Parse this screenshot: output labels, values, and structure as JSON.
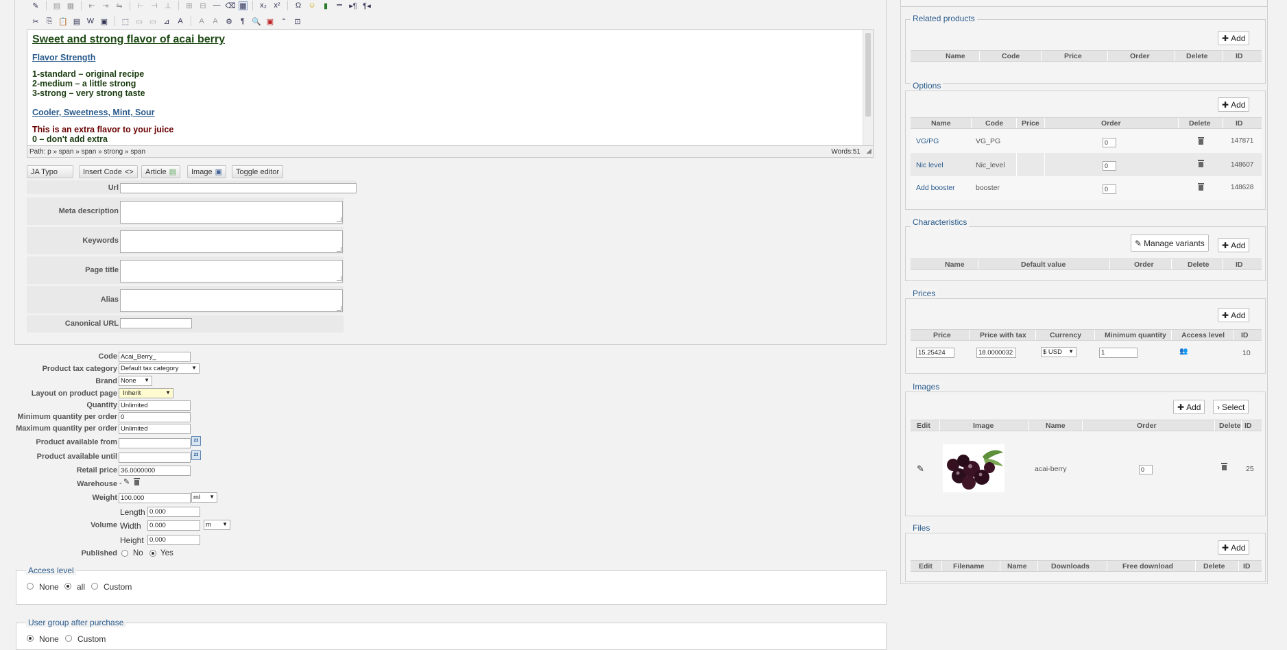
{
  "editor": {
    "content": {
      "title": "Sweet and strong flavor of acai berry",
      "heading1": "Flavor Strength",
      "line1": "1-standard – original recipe",
      "line2": "2-medium – a little strong",
      "line3": "3-strong – very strong taste",
      "heading2": "Cooler, Sweetness, Mint, Sour",
      "line4": "This is an extra flavor to your juice",
      "line5": "0 – don't add extra"
    },
    "path": "Path: p » span » span » strong » span",
    "words": "Words:51",
    "buttons": {
      "ja_typo": "JA Typo",
      "insert_code": "Insert Code",
      "article": "Article",
      "image": "Image",
      "toggle_editor": "Toggle editor"
    }
  },
  "meta_form": {
    "url_label": "Url",
    "meta_description_label": "Meta description",
    "keywords_label": "Keywords",
    "page_title_label": "Page title",
    "alias_label": "Alias",
    "canonical_label": "Canonical URL"
  },
  "product_form": {
    "code": {
      "label": "Code",
      "value": "Acai_Berry_"
    },
    "tax_category": {
      "label": "Product tax category",
      "value": "Default tax category"
    },
    "brand": {
      "label": "Brand",
      "value": "None"
    },
    "layout": {
      "label": "Layout on product page",
      "value": "Inherit"
    },
    "quantity": {
      "label": "Quantity",
      "value": "Unlimited"
    },
    "min_qty": {
      "label": "Minimum quantity per order",
      "value": "0"
    },
    "max_qty": {
      "label": "Maximum quantity per order",
      "value": "Unlimited"
    },
    "available_from": {
      "label": "Product available from",
      "value": ""
    },
    "available_until": {
      "label": "Product available until",
      "value": ""
    },
    "calendar_icon_text": "23",
    "retail_price": {
      "label": "Retail price",
      "value": "36.0000000"
    },
    "warehouse": {
      "label": "Warehouse",
      "value": "-"
    },
    "weight": {
      "label": "Weight",
      "value": "100.000",
      "unit": "ml"
    },
    "volume": {
      "label": "Volume",
      "length_label": "Length",
      "length": "0.000",
      "width_label": "Width",
      "width": "0.000",
      "unit": "m",
      "height_label": "Height",
      "height": "0.000"
    },
    "published": {
      "label": "Published",
      "no": "No",
      "yes": "Yes",
      "selected": "yes"
    }
  },
  "access_level": {
    "legend": "Access level",
    "options": [
      "None",
      "all",
      "Custom"
    ],
    "selected": "all"
  },
  "user_group": {
    "legend": "User group after purchase",
    "options": [
      "None",
      "Custom"
    ],
    "selected": "None"
  },
  "right": {
    "add_label": "Add",
    "related": {
      "legend": "Related products",
      "columns": [
        "Name",
        "Code",
        "Price",
        "Order",
        "Delete",
        "ID"
      ]
    },
    "options": {
      "legend": "Options",
      "columns": [
        "Name",
        "Code",
        "Price",
        "Order",
        "Delete",
        "ID"
      ],
      "rows": [
        {
          "name": "VG/PG",
          "code": "VG_PG",
          "order": "0",
          "id": "147871"
        },
        {
          "name": "Nic level",
          "code": "Nic_level",
          "order": "0",
          "id": "148607"
        },
        {
          "name": "Add booster",
          "code": "booster",
          "order": "0",
          "id": "148628"
        }
      ]
    },
    "characteristics": {
      "legend": "Characteristics",
      "manage_variants": "Manage variants",
      "columns": [
        "Name",
        "Default value",
        "Order",
        "Delete",
        "ID"
      ]
    },
    "prices": {
      "legend": "Prices",
      "columns": [
        "Price",
        "Price with tax",
        "Currency",
        "Minimum quantity",
        "Access level",
        "ID"
      ],
      "row": {
        "price": "15.25424",
        "price_with_tax": "18.0000032",
        "currency": "$ USD",
        "min_qty": "1",
        "id": "10"
      }
    },
    "images": {
      "legend": "Images",
      "select_label": "Select",
      "columns": [
        "Edit",
        "Image",
        "Name",
        "Order",
        "Delete",
        "ID"
      ],
      "row": {
        "name": "acai-berry",
        "order": "0",
        "id": "25"
      }
    },
    "files": {
      "legend": "Files",
      "columns": [
        "Edit",
        "Filename",
        "Name",
        "Downloads",
        "Free download",
        "Delete",
        "ID"
      ]
    }
  }
}
